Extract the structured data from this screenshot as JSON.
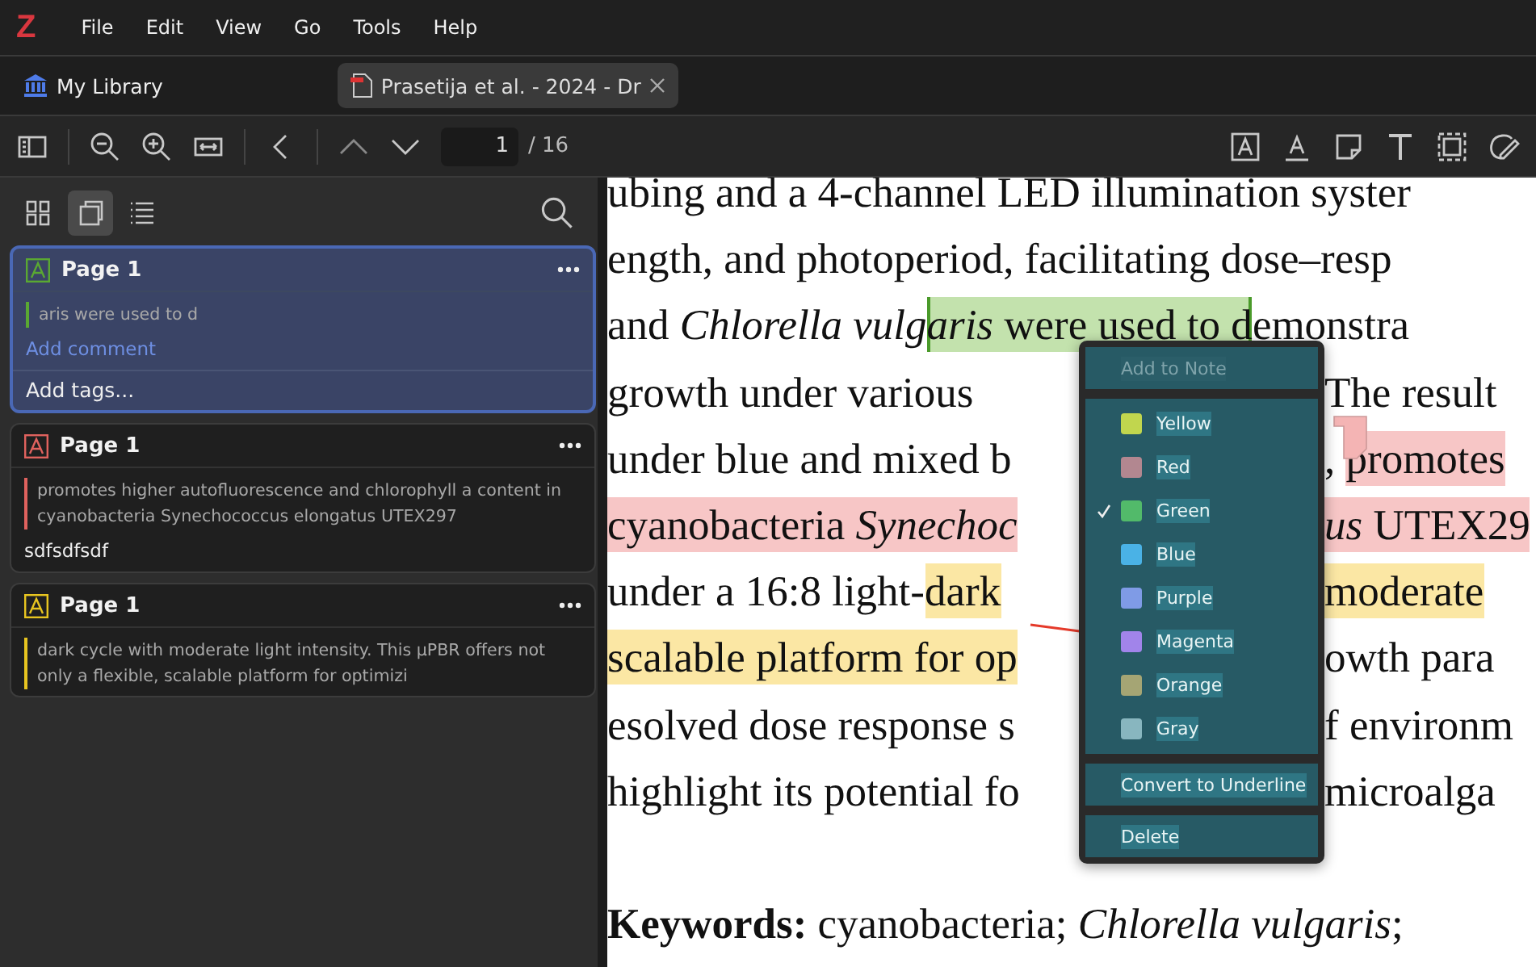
{
  "menu_bar": {
    "logo": "Z",
    "items": [
      "File",
      "Edit",
      "View",
      "Go",
      "Tools",
      "Help"
    ]
  },
  "tabs": [
    {
      "label": "My Library",
      "kind": "library",
      "selected": false
    },
    {
      "label": "Prasetija et al. - 2024 - Dr",
      "kind": "pdf",
      "selected": true
    }
  ],
  "toolbar": {
    "page_input": "1",
    "page_count": "/ 16"
  },
  "sidebar": {
    "view_modes": [
      {
        "kind": "thumbnails",
        "selected": false
      },
      {
        "kind": "annotations",
        "selected": true
      },
      {
        "kind": "outline",
        "selected": false
      }
    ],
    "annotations": [
      {
        "page": "Page 1",
        "color": "#5aa832",
        "selected": true,
        "text": "aris were used to d",
        "comment_placeholder": "Add comment",
        "tags_placeholder": "Add tags..."
      },
      {
        "page": "Page 1",
        "color": "#e0625e",
        "selected": false,
        "text": "promotes higher autofluorescence and chlorophyll a content in cyanobacteria Synechococcus elongatus UTEX297",
        "comment": "sdfsdfsdf"
      },
      {
        "page": "Page 1",
        "color": "#e8c520",
        "selected": false,
        "text": "dark cycle with moderate light intensity. This µPBR offers not only a flexible, scalable platform for optimizi"
      }
    ]
  },
  "document": {
    "lines": [
      {
        "left": [
          {
            "text": "ubing and a 4-channel LED illumination syster"
          }
        ]
      },
      {
        "left": [
          {
            "text": "ength, and photoperiod, facilitating dose–resp"
          }
        ]
      },
      {
        "left": [
          {
            "text": "and *Chlorella vulg*"
          },
          {
            "text": "*aris* were used to d",
            "color": "#c3e2ad",
            "selected": true
          },
          {
            "text": "emonstra"
          }
        ]
      },
      {
        "left": [
          {
            "text": "growth under various"
          }
        ],
        "right": [
          {
            "text": "The result"
          }
        ]
      },
      {
        "left": [
          {
            "text": "under blue and mixed b"
          }
        ],
        "right": [
          {
            "text": ", "
          },
          {
            "text": "promotes",
            "color": "#f7c6c6",
            "selected": false
          }
        ]
      },
      {
        "left": [
          {
            "text": "cyanobacteria *Synechoc*",
            "color": "#f7c6c6",
            "selected": false
          }
        ],
        "right": [
          {
            "text": "*us* UTEX29",
            "color": "#f7c6c6",
            "selected": false
          }
        ]
      },
      {
        "left": [
          {
            "text": "under a 16:8 light-"
          },
          {
            "text": "dark",
            "color": "#fbe7a4",
            "selected": false
          }
        ],
        "right": [
          {
            "text": "moderate",
            "color": "#fbe7a4",
            "selected": false
          }
        ]
      },
      {
        "left": [
          {
            "text": "scalable platform for op",
            "color": "#fbe7a4",
            "selected": false
          }
        ],
        "right": [
          {
            "text": "owth para"
          }
        ]
      },
      {
        "left": [
          {
            "text": "esolved dose response s"
          }
        ],
        "right": [
          {
            "text": "f environm"
          }
        ]
      },
      {
        "left": [
          {
            "text": "highlight its potential fo"
          }
        ],
        "right": [
          {
            "text": "microalga"
          }
        ]
      },
      {
        "kind": "keywords",
        "left": [
          {
            "text": "**Keywords:**  cyanobacteria;  *Chlorella vulgaris*;"
          }
        ]
      }
    ]
  },
  "context_menu": {
    "add_to_note": {
      "label": "Add to Note",
      "disabled": true
    },
    "colors": [
      {
        "label": "Yellow",
        "color": "#c1d64e",
        "checked": false
      },
      {
        "label": "Red",
        "color": "#b28790",
        "checked": false
      },
      {
        "label": "Green",
        "color": "#52ba6a",
        "checked": true
      },
      {
        "label": "Blue",
        "color": "#4ab2e6",
        "checked": false
      },
      {
        "label": "Purple",
        "color": "#7f9be6",
        "checked": false
      },
      {
        "label": "Magenta",
        "color": "#a184ea",
        "checked": false
      },
      {
        "label": "Orange",
        "color": "#a5a574",
        "checked": false
      },
      {
        "label": "Gray",
        "color": "#88b6bf",
        "checked": false
      }
    ],
    "convert": "Convert to Underline",
    "delete": "Delete"
  }
}
